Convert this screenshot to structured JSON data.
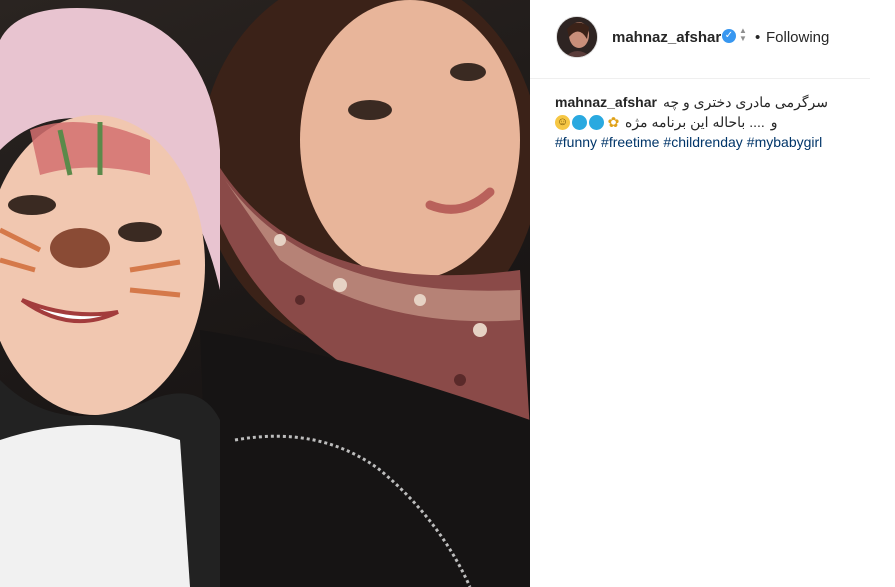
{
  "post": {
    "photo_alt": "selfie photo",
    "header": {
      "username": "mahnaz_afshar",
      "verified_icon": "verified-badge-icon",
      "dot": "•",
      "follow_status": "Following"
    },
    "caption": {
      "username": "mahnaz_afshar",
      "line1": "سرگرمی مادری دختری و چه",
      "line2_text": ".... باحاله این برنامه مژه",
      "line2_mark": "و",
      "emojis": [
        "smile-emoji-icon",
        "blue-circle-emoji-icon",
        "blue-circle-emoji-icon",
        "sunflower-emoji-icon"
      ],
      "hashtags": [
        "#funny",
        "#freetime",
        "#childrenday",
        "#mybabygirl"
      ]
    },
    "colors": {
      "link": "#003569",
      "verified": "#3897f0",
      "text": "#262626"
    }
  }
}
